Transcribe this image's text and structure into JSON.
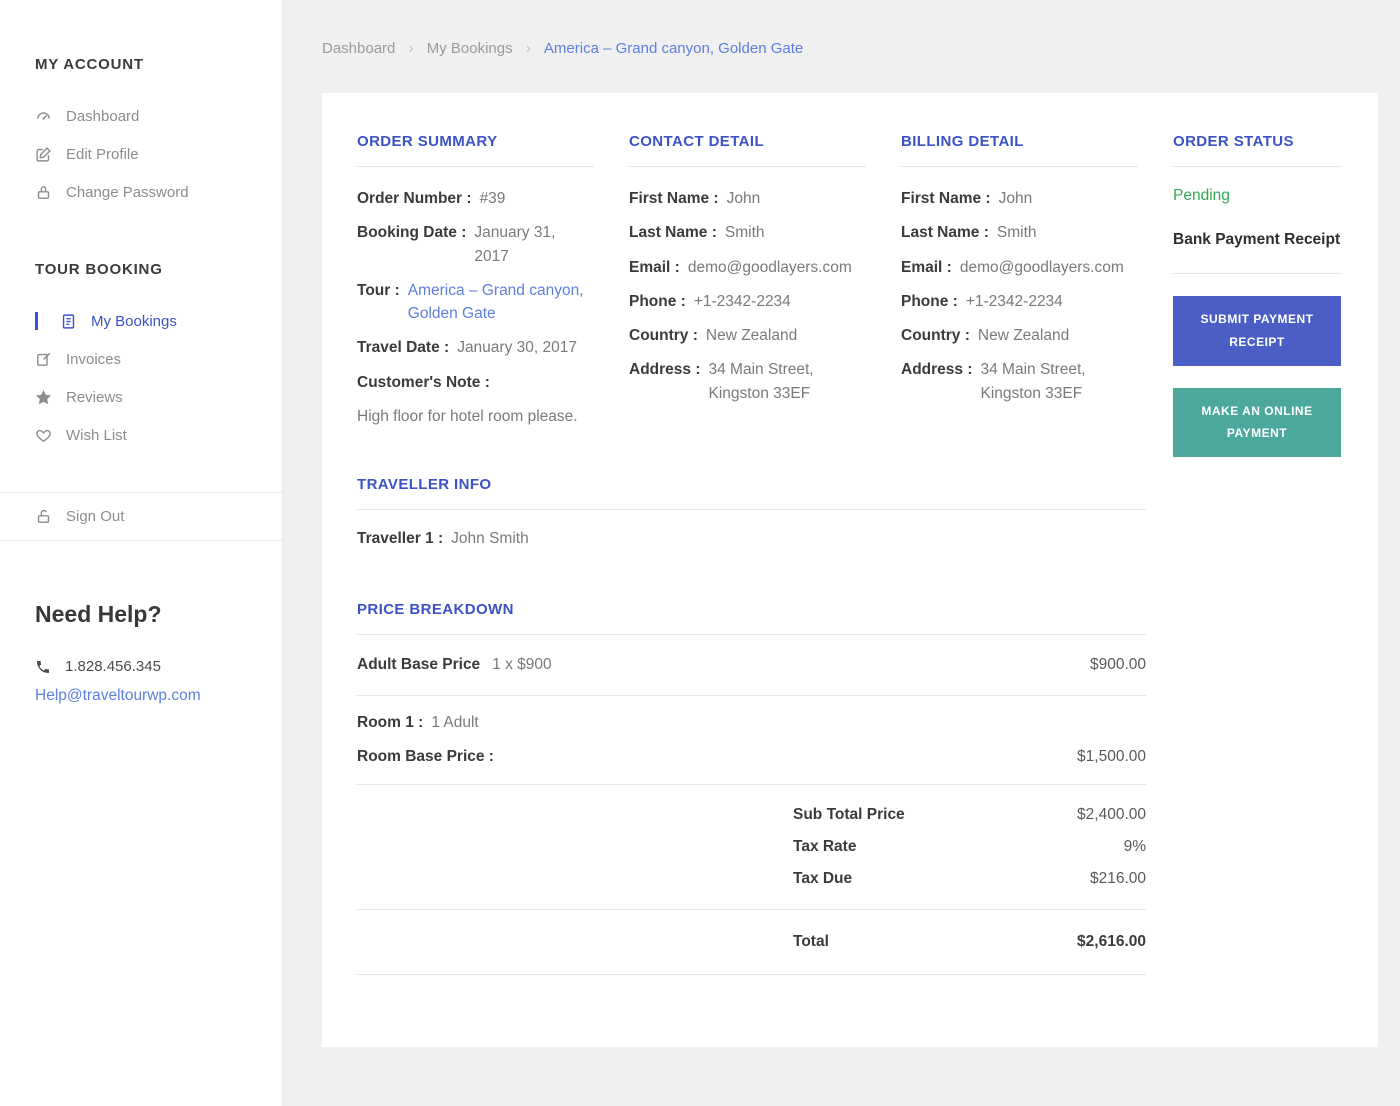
{
  "colors": {
    "heading_blue": "#3d52c5",
    "link_blue": "#5d7fde",
    "pending_green": "#35a854",
    "submit_button_bg": "#4a5ec6",
    "online_button_bg": "#4ca89b"
  },
  "sidebar": {
    "account_title": "MY ACCOUNT",
    "account_items": [
      {
        "label": "Dashboard",
        "icon": "dashboard-icon"
      },
      {
        "label": "Edit Profile",
        "icon": "edit-icon"
      },
      {
        "label": "Change Password",
        "icon": "lock-icon"
      }
    ],
    "booking_title": "TOUR BOOKING",
    "booking_items": [
      {
        "label": "My Bookings",
        "icon": "bookings-icon",
        "active": true
      },
      {
        "label": "Invoices",
        "icon": "invoice-icon"
      },
      {
        "label": "Reviews",
        "icon": "star-icon"
      },
      {
        "label": "Wish List",
        "icon": "heart-icon"
      }
    ],
    "signout_label": "Sign Out",
    "signout_icon": "signout-lock-icon",
    "help_title": "Need Help?",
    "help_phone": "1.828.456.345",
    "help_email": "Help@traveltourwp.com"
  },
  "breadcrumb": {
    "separator": "›",
    "items": [
      "Dashboard",
      "My Bookings",
      "America – Grand canyon, Golden Gate"
    ]
  },
  "order_summary": {
    "title": "ORDER SUMMARY",
    "order_number_label": "Order Number :",
    "order_number": "#39",
    "booking_date_label": "Booking Date :",
    "booking_date": "January 31, 2017",
    "tour_label": "Tour :",
    "tour": "America – Grand canyon, Golden Gate",
    "travel_date_label": "Travel Date :",
    "travel_date": "January 30, 2017",
    "note_label": "Customer's Note :",
    "note": "High floor for hotel room please."
  },
  "contact": {
    "title": "CONTACT DETAIL",
    "fields": [
      {
        "label": "First Name :",
        "value": "John"
      },
      {
        "label": "Last Name :",
        "value": "Smith"
      },
      {
        "label": "Email :",
        "value": "demo@goodlayers.com"
      },
      {
        "label": "Phone :",
        "value": "+1-2342-2234"
      },
      {
        "label": "Country :",
        "value": "New Zealand"
      },
      {
        "label": "Address :",
        "value": "34 Main Street, Kingston 33EF"
      }
    ]
  },
  "billing": {
    "title": "BILLING DETAIL",
    "fields": [
      {
        "label": "First Name :",
        "value": "John"
      },
      {
        "label": "Last Name :",
        "value": "Smith"
      },
      {
        "label": "Email :",
        "value": "demo@goodlayers.com"
      },
      {
        "label": "Phone :",
        "value": "+1-2342-2234"
      },
      {
        "label": "Country :",
        "value": "New Zealand"
      },
      {
        "label": "Address :",
        "value": "34 Main Street, Kingston 33EF"
      }
    ]
  },
  "order_status": {
    "title": "ORDER STATUS",
    "status": "Pending",
    "receipt_title": "Bank Payment Receipt",
    "submit_button": "SUBMIT PAYMENT RECEIPT",
    "online_button": "MAKE AN ONLINE PAYMENT"
  },
  "traveller": {
    "title": "TRAVELLER INFO",
    "label": "Traveller 1 :",
    "value": "John Smith"
  },
  "price_breakdown": {
    "title": "PRICE BREAKDOWN",
    "adult_row": {
      "label": "Adult Base Price",
      "qty": "1 x $900",
      "amount": "$900.00"
    },
    "room_row": {
      "label": "Room 1 :",
      "value": "1 Adult"
    },
    "room_price_row": {
      "label": "Room Base Price :",
      "amount": "$1,500.00"
    },
    "totals": [
      {
        "label": "Sub Total Price",
        "amount": "$2,400.00"
      },
      {
        "label": "Tax Rate",
        "amount": "9%"
      },
      {
        "label": "Tax Due",
        "amount": "$216.00"
      }
    ],
    "total": {
      "label": "Total",
      "amount": "$2,616.00"
    }
  }
}
